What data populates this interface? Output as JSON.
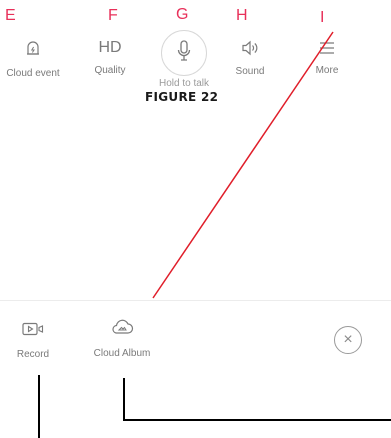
{
  "callouts": {
    "e": "E",
    "f": "F",
    "g": "G",
    "h": "H",
    "i": "I"
  },
  "top_toolbar": {
    "cloud_event_label": "Cloud event",
    "quality_value": "HD",
    "quality_label": "Quality",
    "talk_label": "Hold to talk",
    "sound_label": "Sound",
    "more_label": "More"
  },
  "figure_caption": "FIGURE 22",
  "bottom_bar": {
    "record_label": "Record",
    "cloud_album_label": "Cloud Album",
    "close_symbol": "×"
  },
  "colors": {
    "callout_red": "#e8305a",
    "line_red": "#e01e2a",
    "leader_black": "#000000",
    "icon_gray": "#7a7a7a"
  },
  "icons": {
    "cloud_event": "bell-bolt-icon",
    "talk": "microphone-icon",
    "sound": "speaker-icon",
    "more": "menu-icon",
    "record": "video-record-icon",
    "cloud_album": "cloud-album-icon",
    "close": "close-icon"
  }
}
